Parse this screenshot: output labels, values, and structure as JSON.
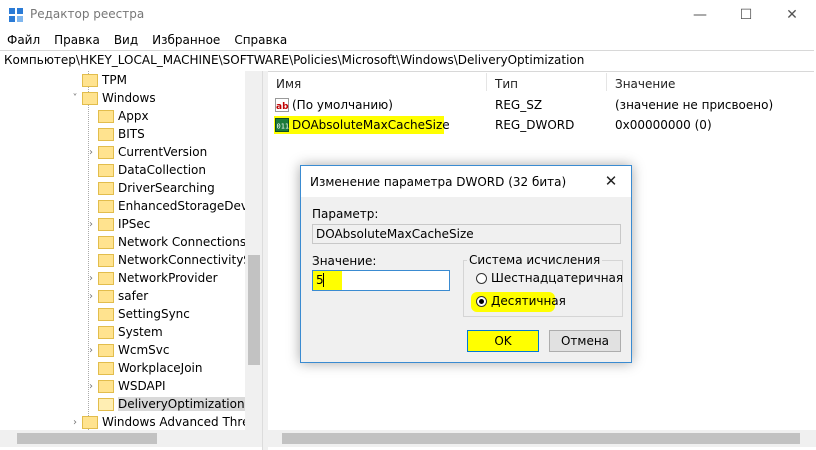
{
  "window": {
    "title": "Редактор реестра",
    "minimize_glyph": "—",
    "maximize_glyph": "☐",
    "close_glyph": "✕"
  },
  "menu": [
    "Файл",
    "Правка",
    "Вид",
    "Избранное",
    "Справка"
  ],
  "address": "Компьютер\\HKEY_LOCAL_MACHINE\\SOFTWARE\\Policies\\Microsoft\\Windows\\DeliveryOptimization",
  "tree": {
    "items": [
      {
        "label": "TPM",
        "level": 0,
        "expander": ""
      },
      {
        "label": "Windows",
        "level": 0,
        "expander": "˅"
      },
      {
        "label": "Appx",
        "level": 1,
        "expander": ""
      },
      {
        "label": "BITS",
        "level": 1,
        "expander": ""
      },
      {
        "label": "CurrentVersion",
        "level": 1,
        "expander": "›"
      },
      {
        "label": "DataCollection",
        "level": 1,
        "expander": ""
      },
      {
        "label": "DriverSearching",
        "level": 1,
        "expander": ""
      },
      {
        "label": "EnhancedStorageDevices",
        "level": 1,
        "expander": ""
      },
      {
        "label": "IPSec",
        "level": 1,
        "expander": "›"
      },
      {
        "label": "Network Connections",
        "level": 1,
        "expander": ""
      },
      {
        "label": "NetworkConnectivityStatusIndicator",
        "level": 1,
        "expander": ""
      },
      {
        "label": "NetworkProvider",
        "level": 1,
        "expander": "›"
      },
      {
        "label": "safer",
        "level": 1,
        "expander": "›"
      },
      {
        "label": "SettingSync",
        "level": 1,
        "expander": ""
      },
      {
        "label": "System",
        "level": 1,
        "expander": ""
      },
      {
        "label": "WcmSvc",
        "level": 1,
        "expander": "›"
      },
      {
        "label": "WorkplaceJoin",
        "level": 1,
        "expander": ""
      },
      {
        "label": "WSDAPI",
        "level": 1,
        "expander": "›"
      },
      {
        "label": "DeliveryOptimization",
        "level": 1,
        "expander": "",
        "selected": true
      },
      {
        "label": "Windows Advanced Threat Protection",
        "level": 0,
        "expander": "›"
      }
    ]
  },
  "list": {
    "headers": {
      "name": "Имя",
      "type": "Тип",
      "value": "Значение"
    },
    "rows": [
      {
        "icon": "string-value-icon",
        "name": "(По умолчанию)",
        "type": "REG_SZ",
        "value": "(значение не присвоено)"
      },
      {
        "icon": "dword-value-icon",
        "name": "DOAbsoluteMaxCacheSize",
        "type": "REG_DWORD",
        "value": "0x00000000 (0)"
      }
    ]
  },
  "dialog": {
    "title": "Изменение параметра DWORD (32 бита)",
    "close_glyph": "✕",
    "param_label": "Параметр:",
    "param_value": "DOAbsoluteMaxCacheSize",
    "value_label": "Значение:",
    "value": "5",
    "base_group": "Система исчисления",
    "radio_hex": "Шестнадцатеричная",
    "radio_dec": "Десятичная",
    "selected_base": "dec",
    "ok": "OK",
    "cancel": "Отмена"
  },
  "colors": {
    "highlight": "#ffff00",
    "accent": "#0078d7"
  }
}
